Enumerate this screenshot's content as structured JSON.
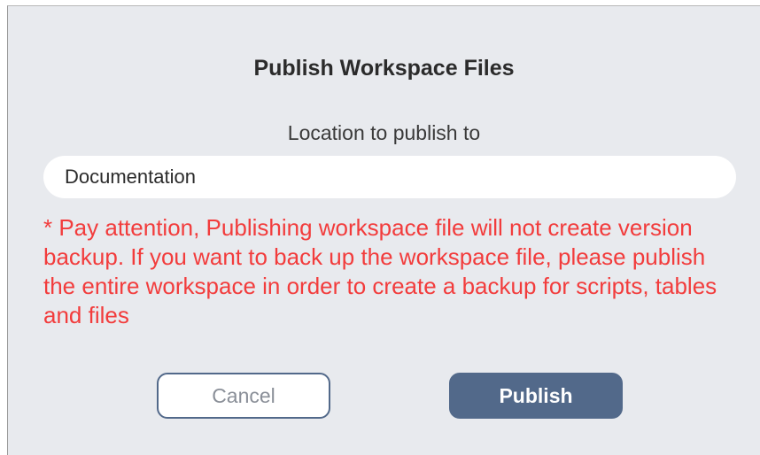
{
  "dialog": {
    "title": "Publish Workspace Files",
    "location_label": "Location to publish to",
    "location_value": "Documentation",
    "warning": "* Pay attention, Publishing workspace file will not create version backup. If you want to back up the workspace file, please publish the entire workspace in order to create a backup for scripts, tables and files",
    "cancel_label": "Cancel",
    "publish_label": "Publish"
  },
  "colors": {
    "background": "#e8eaee",
    "warning": "#f23c3c",
    "primary_button": "#52698a"
  }
}
